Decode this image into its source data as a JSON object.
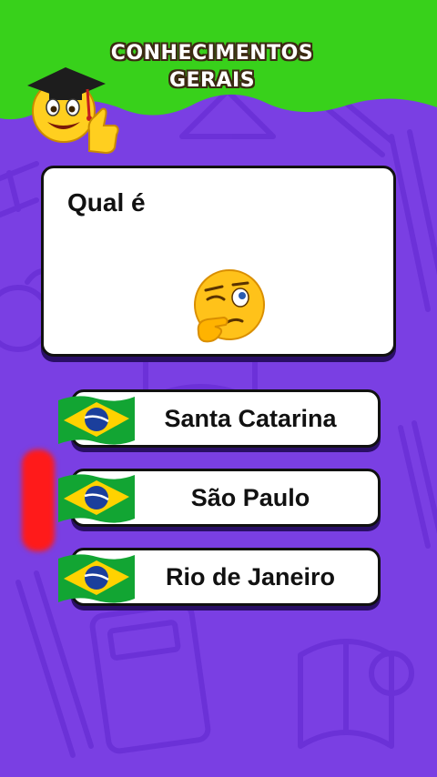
{
  "header": {
    "title_line1": "CONHECIMENTOS",
    "title_line2": "GERAIS",
    "mascot_icon": "graduate-smiley-thumbs-up-icon",
    "band_color": "#38d11b"
  },
  "question": {
    "text": "Qual é",
    "emoji_icon": "thinking-wink-emoji-icon"
  },
  "answers": [
    {
      "label": "Santa Catarina",
      "flag_icon": "brazil-flag-icon"
    },
    {
      "label": "São Paulo",
      "flag_icon": "brazil-flag-icon"
    },
    {
      "label": "Rio de Janeiro",
      "flag_icon": "brazil-flag-icon"
    }
  ],
  "colors": {
    "background": "#7a3fe3",
    "header_green": "#38d11b",
    "card_border": "#111111",
    "flag_green": "#12a533",
    "flag_yellow": "#ffd200",
    "flag_blue": "#1b3f9c",
    "highlight_red": "#ff1a1a"
  }
}
